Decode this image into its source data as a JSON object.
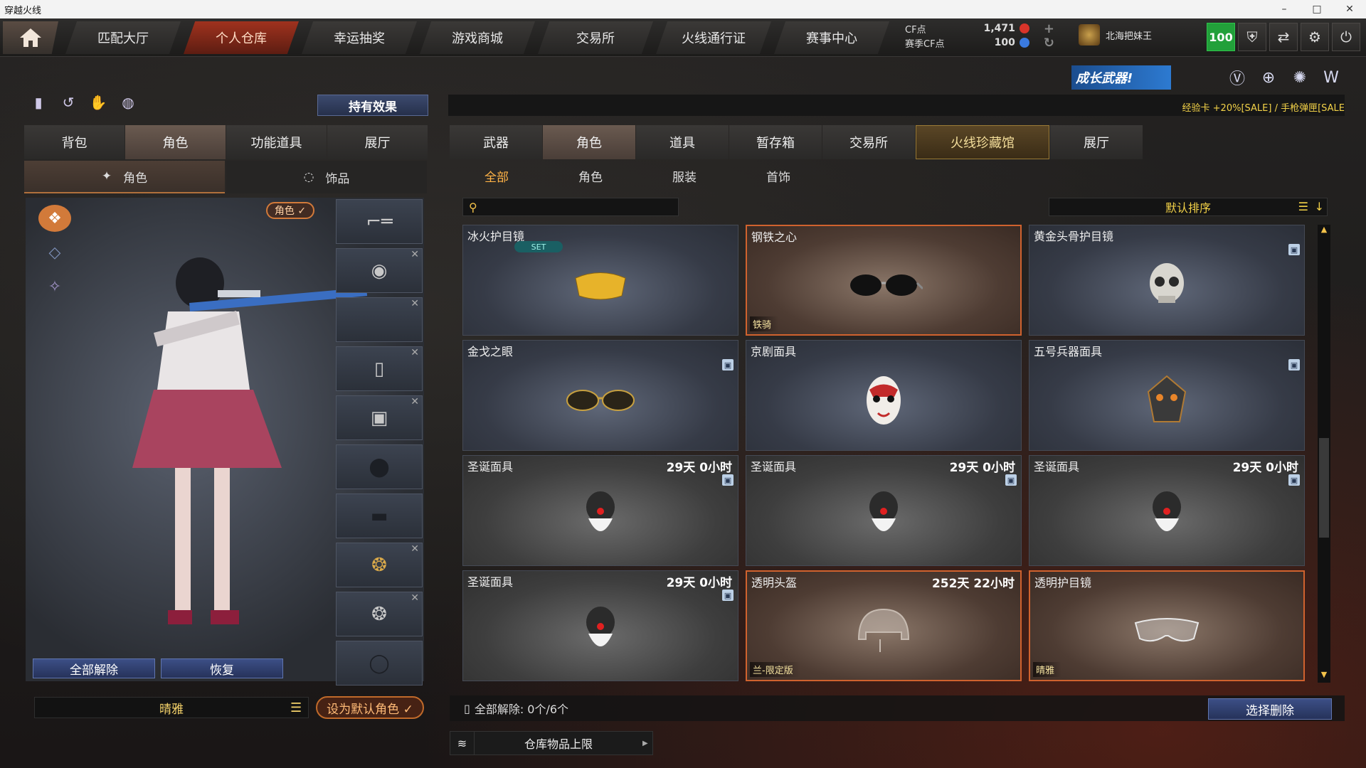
{
  "window": {
    "title": "穿越火线",
    "controls": [
      "–",
      "□",
      "✕"
    ]
  },
  "nav": {
    "tabs": [
      "匹配大厅",
      "个人仓库",
      "幸运抽奖",
      "游戏商城",
      "交易所",
      "火线通行证",
      "赛事中心"
    ],
    "active": 1
  },
  "currency": {
    "cf_label": "CF点",
    "cf_value": "1,471",
    "season_label": "赛季CF点",
    "season_value": "100"
  },
  "player": {
    "name": "北海把妹王",
    "level": "100"
  },
  "banner": {
    "text": "成长武器!"
  },
  "ticker": "经验卡 +20%[SALE] / 手枪弹匣[SALE",
  "left": {
    "effect_button": "持有效果",
    "tabs": [
      "背包",
      "角色",
      "功能道具",
      "展厅"
    ],
    "active_tab": 1,
    "sub_tabs": [
      "角色",
      "饰品"
    ],
    "role_badge": "角色 ✓",
    "unequip_all": "全部解除",
    "restore": "恢复",
    "character_name": "晴雅",
    "set_default": "设为默认角色 ✓"
  },
  "right": {
    "tabs": [
      "武器",
      "角色",
      "道具",
      "暂存箱",
      "交易所",
      "火线珍藏馆",
      "展厅"
    ],
    "active_tab": 1,
    "sub_tabs": [
      "全部",
      "角色",
      "服装",
      "首饰"
    ],
    "active_sub": 0,
    "search_placeholder": "",
    "sort_label": "默认排序",
    "unequip_all_status": "全部解除: 0个/6个",
    "select_delete": "选择删除",
    "storage_limit": "仓库物品上限"
  },
  "items": [
    {
      "name": "冰火护目镜",
      "time": "",
      "tag": "",
      "set": "SET",
      "lock": false,
      "style": "blue"
    },
    {
      "name": "钢铁之心",
      "time": "",
      "tag": "铁骑",
      "set": "",
      "lock": false,
      "style": "orange"
    },
    {
      "name": "黄金头骨护目镜",
      "time": "",
      "tag": "",
      "set": "",
      "lock": true,
      "style": "blue"
    },
    {
      "name": "金戈之眼",
      "time": "",
      "tag": "",
      "set": "",
      "lock": true,
      "style": "blue"
    },
    {
      "name": "京剧面具",
      "time": "",
      "tag": "",
      "set": "",
      "lock": false,
      "style": "blue"
    },
    {
      "name": "五号兵器面具",
      "time": "",
      "tag": "",
      "set": "",
      "lock": true,
      "style": "blue"
    },
    {
      "name": "圣诞面具",
      "time": "29天 0小时",
      "tag": "",
      "set": "",
      "lock": true,
      "style": "gray"
    },
    {
      "name": "圣诞面具",
      "time": "29天 0小时",
      "tag": "",
      "set": "",
      "lock": true,
      "style": "gray"
    },
    {
      "name": "圣诞面具",
      "time": "29天 0小时",
      "tag": "",
      "set": "",
      "lock": true,
      "style": "gray"
    },
    {
      "name": "圣诞面具",
      "time": "29天 0小时",
      "tag": "",
      "set": "",
      "lock": true,
      "style": "gray"
    },
    {
      "name": "透明头盔",
      "time": "252天 22小时",
      "tag": "兰-限定版",
      "set": "",
      "lock": false,
      "style": "orange"
    },
    {
      "name": "透明护目镜",
      "time": "",
      "tag": "晴雅",
      "set": "",
      "lock": false,
      "style": "orange"
    }
  ]
}
